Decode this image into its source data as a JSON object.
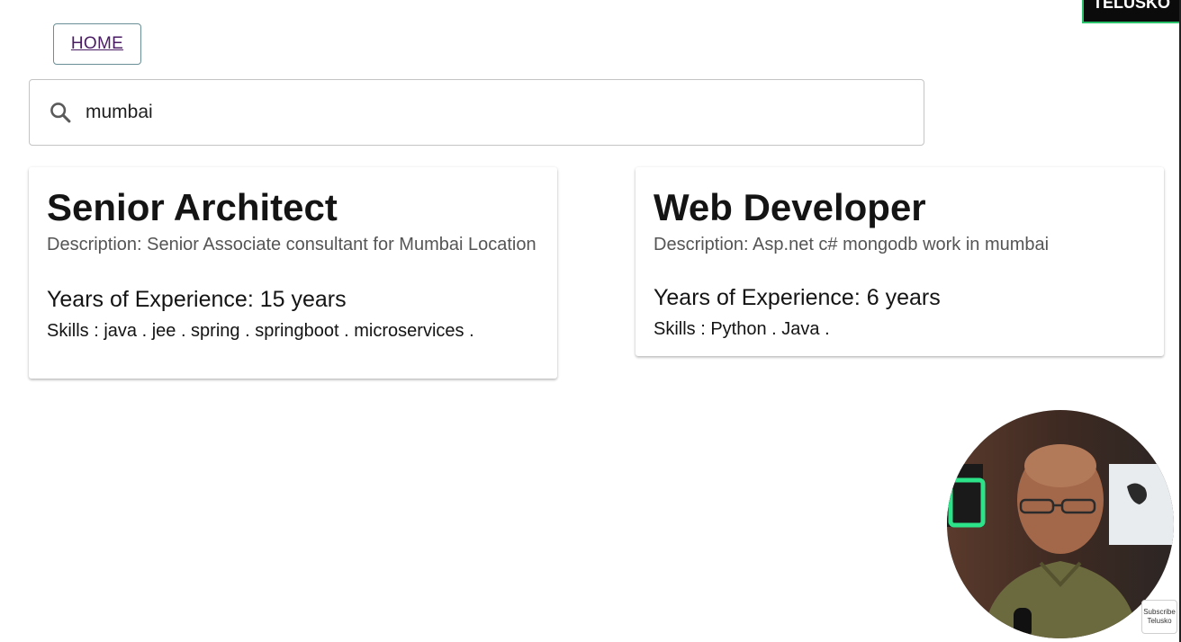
{
  "nav": {
    "home_label": "HOME"
  },
  "brand": {
    "label": "TELUSKO"
  },
  "search": {
    "value": "mumbai",
    "icon": "search-icon"
  },
  "jobs": [
    {
      "title": "Senior Architect",
      "description": "Description: Senior Associate consultant for Mumbai Location",
      "experience": "Years of Experience: 15 years",
      "skills": "Skills : java . jee . spring . springboot . microservices ."
    },
    {
      "title": "Web Developer",
      "description": "Description: Asp.net c# mongodb work in mumbai",
      "experience": "Years of Experience: 6 years",
      "skills": "Skills : Python . Java ."
    }
  ],
  "overlay": {
    "subscribe_line1": "Subscribe",
    "subscribe_line2": "Telusko"
  },
  "colors": {
    "link": "#4a1c63",
    "brand_border": "#29c26a",
    "brand_bg": "#0b0b0b"
  }
}
